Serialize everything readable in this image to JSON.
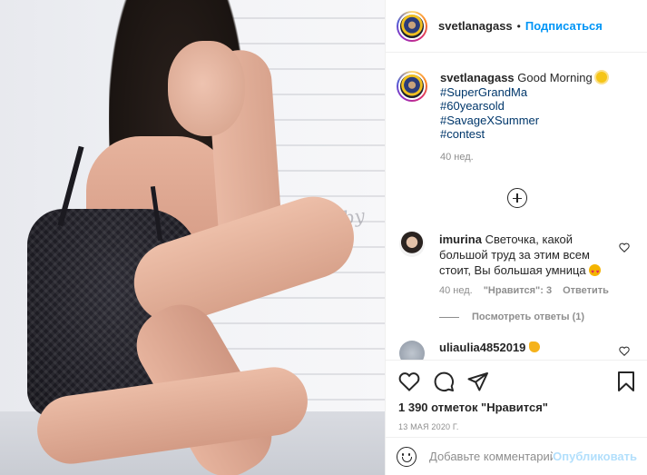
{
  "header": {
    "username": "svetlanagass",
    "separator": "•",
    "follow_label": "Подписаться"
  },
  "caption": {
    "username": "svetlanagass",
    "text": "Good Morning",
    "hashtags": [
      "#SuperGrandMa",
      "#60yearsold",
      "#SavageXSummer",
      "#contest"
    ],
    "time": "40 нед."
  },
  "comments": [
    {
      "username": "imurina",
      "text": "Светочка, какой большой труд за этим всем стоит, Вы большая умница",
      "time": "40 нед.",
      "likes": "\"Нравится\": 3",
      "reply_label": "Ответить",
      "view_replies": "Посмотреть ответы (1)"
    },
    {
      "username": "uliaulia4852019"
    }
  ],
  "actions": {
    "likes_count": "1 390 отметок \"Нравится\"",
    "date": "13 МАЯ 2020 Г."
  },
  "add_comment": {
    "placeholder": "Добавьте комментарий...",
    "post_label": "Опубликовать"
  },
  "photo": {
    "graffiti": "love by"
  },
  "colors": {
    "link_blue": "#0095f6",
    "hashtag": "#00376b",
    "muted": "#8e8e8e",
    "post_disabled": "#b2dffc"
  }
}
